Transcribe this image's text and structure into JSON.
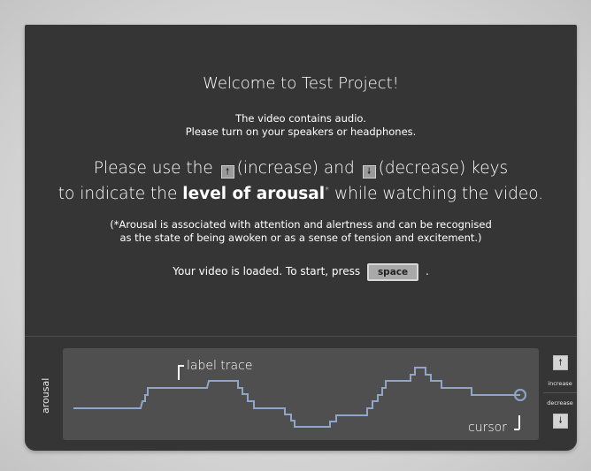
{
  "welcome": {
    "title": "Welcome to Test Project!"
  },
  "audio_notice": {
    "line1": "The video contains audio.",
    "line2": "Please turn on your speakers or headphones."
  },
  "instruction": {
    "part1": "Please use the",
    "increase_text": "(increase) and",
    "decrease_text": "(decrease) keys",
    "part2": "to indicate the",
    "emphasis": "level of arousal",
    "asterisk": "*",
    "part3": "while watching the video.",
    "increase_icon": "arrow-up-key-icon",
    "decrease_icon": "arrow-down-key-icon"
  },
  "note": {
    "line1": "(*Arousal is associated with attention and alertness and can be recognised",
    "line2": "as the state of being awoken or as a sense of tension and excitement.)"
  },
  "start_prompt": {
    "text": "Your video is loaded. To start, press",
    "key": "space",
    "suffix": "."
  },
  "trace_panel": {
    "axis_label": "arousal",
    "label_trace": "label trace",
    "cursor_label": "cursor",
    "trace_color": "#8fa6c9",
    "cursor_color": "#8fa6c9"
  },
  "controls": {
    "increase_label": "increase",
    "decrease_label": "decrease",
    "increase_icon": "arrow-up-icon",
    "decrease_icon": "arrow-down-icon"
  },
  "colors": {
    "panel_bg": "#353535",
    "trace_bg": "#4f4f4f",
    "text": "#ffffff"
  }
}
